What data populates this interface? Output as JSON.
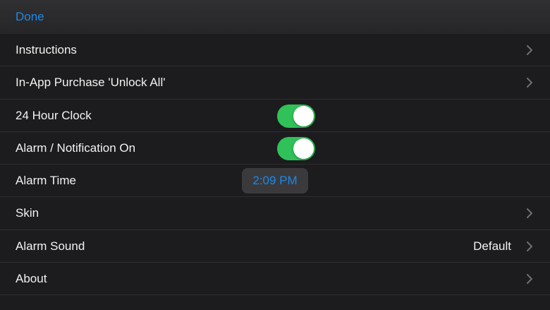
{
  "navbar": {
    "done_label": "Done"
  },
  "colors": {
    "accent": "#1e88e5",
    "toggle_on": "#30c158",
    "background": "#1c1c1e"
  },
  "settings": {
    "instructions": {
      "label": "Instructions",
      "icon": "chevron-right-icon"
    },
    "purchase": {
      "label": "In-App Purchase 'Unlock All'",
      "icon": "chevron-right-icon"
    },
    "clock24": {
      "label": "24 Hour Clock",
      "toggle_on": true
    },
    "alarm_notification": {
      "label": "Alarm / Notification On",
      "toggle_on": true
    },
    "alarm_time": {
      "label": "Alarm Time",
      "value": "2:09 PM"
    },
    "skin": {
      "label": "Skin",
      "icon": "chevron-right-icon"
    },
    "alarm_sound": {
      "label": "Alarm Sound",
      "value": "Default",
      "icon": "chevron-right-icon"
    },
    "about": {
      "label": "About",
      "icon": "chevron-right-icon"
    }
  }
}
